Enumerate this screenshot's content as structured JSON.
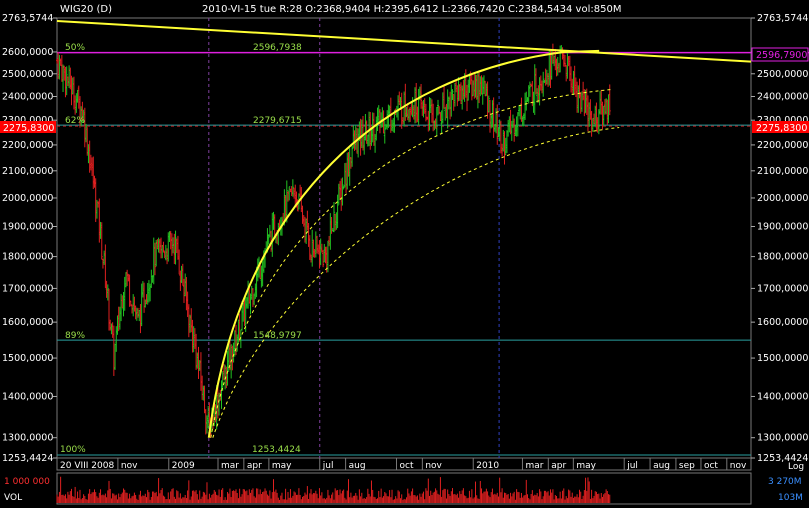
{
  "header": {
    "symbol": "WIG20 (D)",
    "ohlc": "2010-VI-15  tue   R:28 O:2368,9404 H:2395,6412 L:2366,7420 C:2384,5434 vol:850M"
  },
  "colors": {
    "background": "#000000",
    "up_candle": "#22c222",
    "down_candle": "#e02020",
    "trendline": "#ffff33",
    "magenta_level": "#e020e0",
    "cyan_level": "#2aa0a0",
    "fib_text": "#9adf4a",
    "volume": "#e02020",
    "price_label_bg": "#ff0000",
    "time_marker": "#8040a0",
    "time_marker_blue": "#3040c0"
  },
  "axis": {
    "y_ticks": [
      "2763,5744",
      "2600,0000",
      "2500,0000",
      "2400,0000",
      "2300,0000",
      "2200,0000",
      "2100,0000",
      "2000,0000",
      "1900,0000",
      "1800,0000",
      "1700,0000",
      "1600,0000",
      "1500,0000",
      "1400,0000",
      "1300,0000",
      "1253,4424"
    ],
    "y_tick_values": [
      2763.5744,
      2600,
      2500,
      2400,
      2300,
      2200,
      2100,
      2000,
      1900,
      1800,
      1700,
      1600,
      1500,
      1400,
      1300,
      1253.4424
    ],
    "y_range": [
      1253.4424,
      2763.5744
    ],
    "scale": "Log",
    "x_ticks": [
      "20 VIII 2008",
      "nov",
      "2009",
      "mar",
      "apr",
      "may",
      "jul",
      "aug",
      "oct",
      "nov",
      "2010",
      "mar",
      "apr",
      "may",
      "jul",
      "aug",
      "sep",
      "oct",
      "nov"
    ],
    "x_tick_dates": [
      "2008-08-20",
      "2008-11-01",
      "2009-01-01",
      "2009-03-01",
      "2009-04-01",
      "2009-05-01",
      "2009-07-01",
      "2009-08-01",
      "2009-10-01",
      "2009-11-01",
      "2010-01-01",
      "2010-03-01",
      "2010-04-01",
      "2010-05-01",
      "2010-07-01",
      "2010-08-01",
      "2010-09-01",
      "2010-10-01",
      "2010-11-01"
    ],
    "x_range": [
      "2008-08-20",
      "2010-11-30"
    ],
    "scale_label": "Log"
  },
  "levels": {
    "top": {
      "pct": "50%",
      "value": "2596,7938",
      "right_label": "2596,7900",
      "y": 2596.79
    },
    "mid": {
      "pct": "62%",
      "value": "2279,6715",
      "y": 2279.67
    },
    "low": {
      "pct": "89%",
      "value": "1548,9797",
      "y": 1548.98
    },
    "bottom": {
      "pct": "100%",
      "value": "1253,4424"
    },
    "current_price": "2275,8300",
    "current_y": 2275.83
  },
  "markers": [
    "2009-02-18",
    "2009-07-01",
    "2010-02-01"
  ],
  "volume": {
    "label": "VOL",
    "max_label": "1 000 000",
    "right_top": "3 270M",
    "right_bottom": "103M"
  },
  "chart_data": {
    "type": "candlestick",
    "title": "WIG20 (D)",
    "scale": "log",
    "ylim": [
      1253.4424,
      2763.5744
    ],
    "anchors": [
      {
        "date": "2008-08-20",
        "close": 2560
      },
      {
        "date": "2008-09-01",
        "close": 2480
      },
      {
        "date": "2008-09-20",
        "close": 2330
      },
      {
        "date": "2008-10-10",
        "close": 1900
      },
      {
        "date": "2008-10-27",
        "close": 1500
      },
      {
        "date": "2008-11-10",
        "close": 1750
      },
      {
        "date": "2008-11-25",
        "close": 1600
      },
      {
        "date": "2008-12-15",
        "close": 1800
      },
      {
        "date": "2009-01-08",
        "close": 1850
      },
      {
        "date": "2009-01-25",
        "close": 1620
      },
      {
        "date": "2009-02-18",
        "close": 1320
      },
      {
        "date": "2009-03-10",
        "close": 1460
      },
      {
        "date": "2009-04-05",
        "close": 1650
      },
      {
        "date": "2009-05-08",
        "close": 1900
      },
      {
        "date": "2009-06-01",
        "close": 2030
      },
      {
        "date": "2009-06-20",
        "close": 1830
      },
      {
        "date": "2009-07-08",
        "close": 1800
      },
      {
        "date": "2009-08-10",
        "close": 2200
      },
      {
        "date": "2009-09-15",
        "close": 2300
      },
      {
        "date": "2009-10-20",
        "close": 2380
      },
      {
        "date": "2009-11-15",
        "close": 2300
      },
      {
        "date": "2009-12-10",
        "close": 2420
      },
      {
        "date": "2010-01-10",
        "close": 2460
      },
      {
        "date": "2010-02-05",
        "close": 2200
      },
      {
        "date": "2010-03-01",
        "close": 2350
      },
      {
        "date": "2010-04-01",
        "close": 2540
      },
      {
        "date": "2010-04-20",
        "close": 2560
      },
      {
        "date": "2010-05-05",
        "close": 2420
      },
      {
        "date": "2010-05-25",
        "close": 2300
      },
      {
        "date": "2010-06-15",
        "close": 2384.5434
      }
    ]
  }
}
